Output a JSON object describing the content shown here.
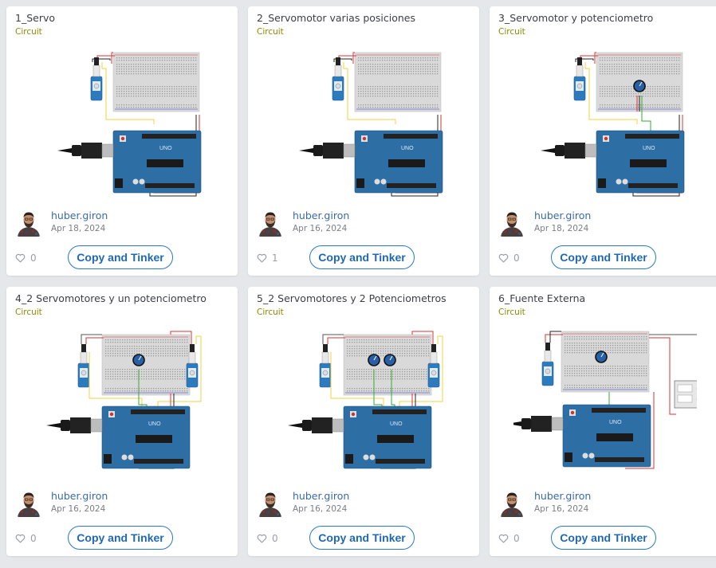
{
  "projects": [
    {
      "title": "1_Servo",
      "type": "Circuit",
      "author": "huber.giron",
      "date": "Apr 18, 2024",
      "likes": "0",
      "button": "Copy and Tinker",
      "variant": "simple"
    },
    {
      "title": "2_Servomotor varias posiciones",
      "type": "Circuit",
      "author": "huber.giron",
      "date": "Apr 16, 2024",
      "likes": "1",
      "button": "Copy and Tinker",
      "variant": "simple"
    },
    {
      "title": "3_Servomotor y potenciometro",
      "type": "Circuit",
      "author": "huber.giron",
      "date": "Apr 18, 2024",
      "likes": "0",
      "button": "Copy and Tinker",
      "variant": "pot"
    },
    {
      "title": "4_2 Servomotores y un potenciometro",
      "type": "Circuit",
      "author": "huber.giron",
      "date": "Apr 16, 2024",
      "likes": "0",
      "button": "Copy and Tinker",
      "variant": "two-servo-one-pot"
    },
    {
      "title": "5_2 Servomotores y 2 Potenciometros",
      "type": "Circuit",
      "author": "huber.giron",
      "date": "Apr 16, 2024",
      "likes": "0",
      "button": "Copy and Tinker",
      "variant": "two-servo-two-pot"
    },
    {
      "title": "6_Fuente Externa",
      "type": "Circuit",
      "author": "huber.giron",
      "date": "Apr 16, 2024",
      "likes": "0",
      "button": "Copy and Tinker",
      "variant": "power-supply"
    }
  ],
  "icons": {
    "like": "heart-outline-icon",
    "avatar": "user-avatar"
  },
  "colors": {
    "button_border": "#2878c8",
    "button_text": "#1f68b6",
    "author": "#3a6aa8",
    "circuit_label": "#8a8a00",
    "arduino": "#2d6ea5",
    "page_bg": "#e6e7ea"
  }
}
